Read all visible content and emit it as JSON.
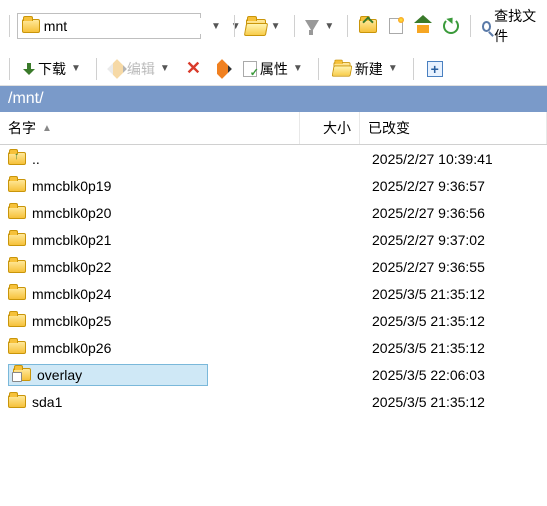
{
  "path_combo": {
    "value": "mnt"
  },
  "toolbar": {
    "find_files_label": "查找文件",
    "download_label": "下载",
    "edit_label": "编辑",
    "properties_label": "属性",
    "new_label": "新建"
  },
  "pathbar": "/mnt/",
  "columns": {
    "name": "名字",
    "size": "大小",
    "modified": "已改变"
  },
  "rows": [
    {
      "type": "updir",
      "name": "..",
      "size": "",
      "modified": "2025/2/27 10:39:41",
      "selected": false
    },
    {
      "type": "folder",
      "name": "mmcblk0p19",
      "size": "",
      "modified": "2025/2/27 9:36:57",
      "selected": false
    },
    {
      "type": "folder",
      "name": "mmcblk0p20",
      "size": "",
      "modified": "2025/2/27 9:36:56",
      "selected": false
    },
    {
      "type": "folder",
      "name": "mmcblk0p21",
      "size": "",
      "modified": "2025/2/27 9:37:02",
      "selected": false
    },
    {
      "type": "folder",
      "name": "mmcblk0p22",
      "size": "",
      "modified": "2025/2/27 9:36:55",
      "selected": false
    },
    {
      "type": "folder",
      "name": "mmcblk0p24",
      "size": "",
      "modified": "2025/3/5 21:35:12",
      "selected": false
    },
    {
      "type": "folder",
      "name": "mmcblk0p25",
      "size": "",
      "modified": "2025/3/5 21:35:12",
      "selected": false
    },
    {
      "type": "folder",
      "name": "mmcblk0p26",
      "size": "",
      "modified": "2025/3/5 21:35:12",
      "selected": false
    },
    {
      "type": "link",
      "name": "overlay",
      "size": "",
      "modified": "2025/3/5 22:06:03",
      "selected": true
    },
    {
      "type": "folder",
      "name": "sda1",
      "size": "",
      "modified": "2025/3/5 21:35:12",
      "selected": false
    }
  ]
}
